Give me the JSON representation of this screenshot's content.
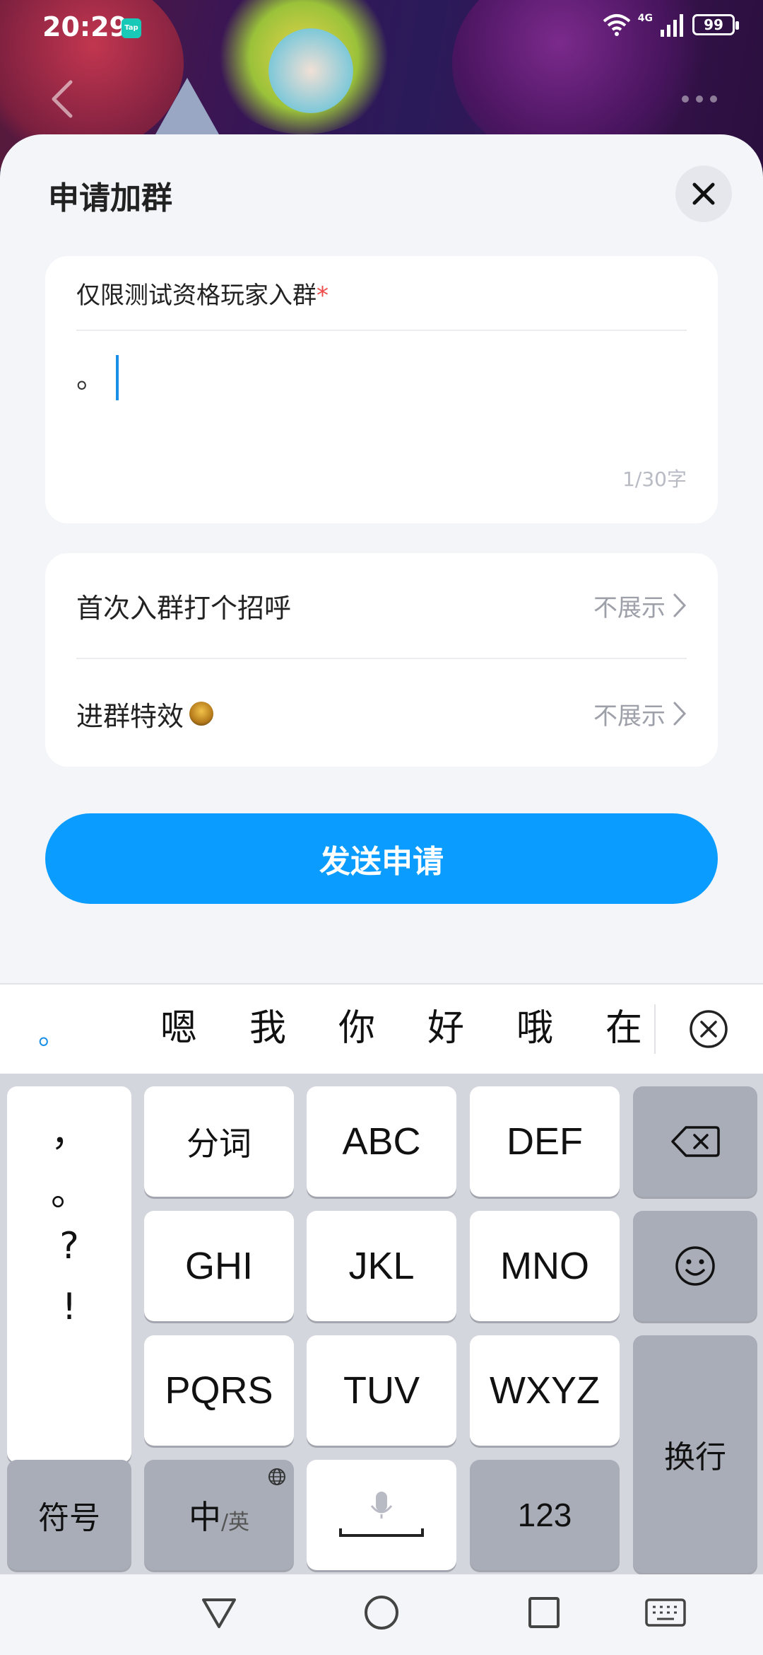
{
  "status_bar": {
    "time": "20:29",
    "app_badge": "Tap",
    "network": "4G",
    "battery": "99"
  },
  "sheet": {
    "title": "申请加群"
  },
  "question": {
    "label": "仅限测试资格玩家入群",
    "required_mark": "*",
    "answer": "。",
    "char_count": "1/30字"
  },
  "options": [
    {
      "label": "首次入群打个招呼",
      "value": "不展示"
    },
    {
      "label": "进群特效",
      "value": "不展示"
    }
  ],
  "send_button": "发送申请",
  "ime": {
    "pinyin": "。",
    "candidates": [
      "嗯",
      "我",
      "你",
      "好",
      "哦",
      "在"
    ]
  },
  "keyboard": {
    "punctuation": [
      "，",
      "。",
      "?",
      "!"
    ],
    "row1": [
      "分词",
      "ABC",
      "DEF"
    ],
    "row2": [
      "GHI",
      "JKL",
      "MNO"
    ],
    "row3": [
      "PQRS",
      "TUV",
      "WXYZ"
    ],
    "symbols": "符号",
    "lang_main": "中",
    "lang_sub": "/英",
    "numbers": "123",
    "enter": "换行"
  },
  "colors": {
    "accent": "#0b9cff",
    "required": "#ee4a4a",
    "sheet_bg": "#f4f5f9"
  }
}
